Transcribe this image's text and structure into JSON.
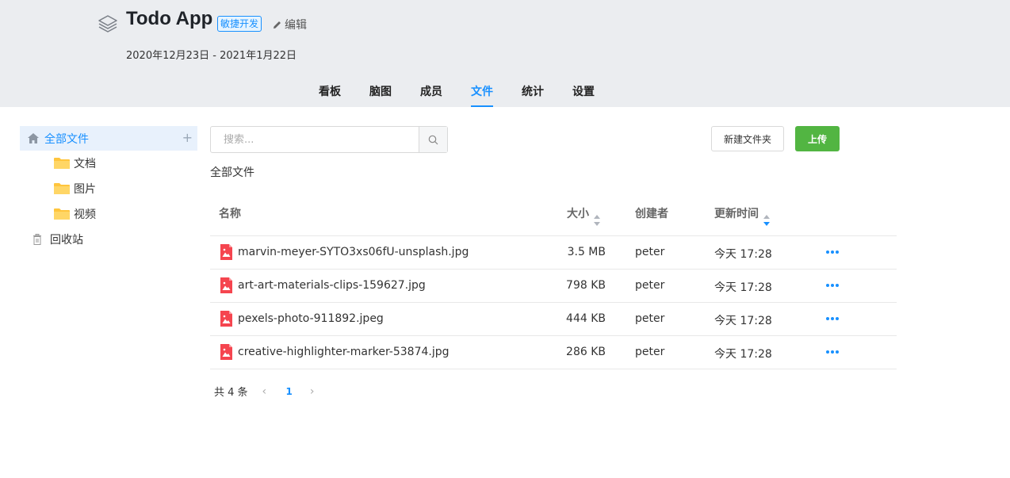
{
  "project": {
    "title": "Todo App",
    "tag": "敏捷开发",
    "edit_label": "编辑",
    "dates": "2020年12月23日 - 2021年1月22日"
  },
  "tabs": [
    {
      "label": "看板",
      "active": false
    },
    {
      "label": "脑图",
      "active": false
    },
    {
      "label": "成员",
      "active": false
    },
    {
      "label": "文件",
      "active": true
    },
    {
      "label": "统计",
      "active": false
    },
    {
      "label": "设置",
      "active": false
    }
  ],
  "sidebar": {
    "root_label": "全部文件",
    "add_symbol": "+",
    "folders": [
      {
        "label": "文档"
      },
      {
        "label": "图片"
      },
      {
        "label": "视频"
      }
    ],
    "trash_label": "回收站"
  },
  "toolbar": {
    "search_placeholder": "搜索...",
    "new_folder_label": "新建文件夹",
    "upload_label": "上传"
  },
  "breadcrumb": "全部文件",
  "table": {
    "columns": {
      "name": "名称",
      "size": "大小",
      "creator": "创建者",
      "updated": "更新时间"
    },
    "rows": [
      {
        "name": "marvin-meyer-SYTO3xs06fU-unsplash.jpg",
        "size": "3.5 MB",
        "creator": "peter",
        "time": "今天 17:28"
      },
      {
        "name": "art-art-materials-clips-159627.jpg",
        "size": "798 KB",
        "creator": "peter",
        "time": "今天 17:28"
      },
      {
        "name": "pexels-photo-911892.jpeg",
        "size": "444 KB",
        "creator": "peter",
        "time": "今天 17:28"
      },
      {
        "name": "creative-highlighter-marker-53874.jpg",
        "size": "286 KB",
        "creator": "peter",
        "time": "今天 17:28"
      }
    ]
  },
  "pagination": {
    "total_label": "共 4 条",
    "current_page": "1",
    "prev_symbol": "‹",
    "next_symbol": "›"
  },
  "colors": {
    "accent": "#1890ff",
    "upload_button": "#52b542",
    "header_bg": "#ebedf0",
    "file_icon": "#f5454f",
    "folder_icon": "#ffc53d"
  }
}
